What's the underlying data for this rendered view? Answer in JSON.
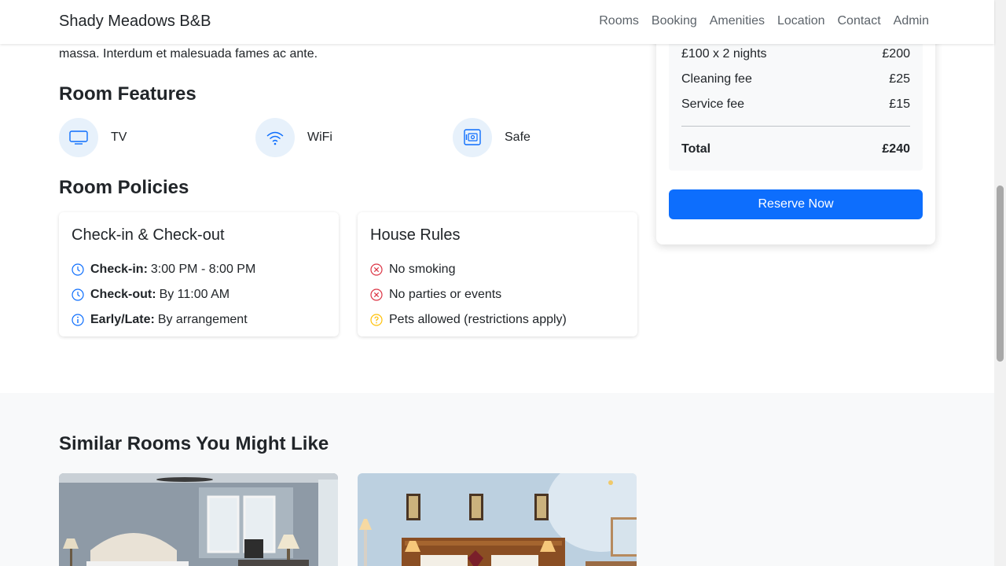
{
  "nav": {
    "brand": "Shady Meadows B&B",
    "links": [
      "Rooms",
      "Booking",
      "Amenities",
      "Location",
      "Contact",
      "Admin"
    ]
  },
  "description_tail": "massa. Interdum et malesuada fames ac ante.",
  "features": {
    "title": "Room Features",
    "items": [
      {
        "label": "TV",
        "icon": "tv-icon"
      },
      {
        "label": "WiFi",
        "icon": "wifi-icon"
      },
      {
        "label": "Safe",
        "icon": "safe-icon"
      }
    ]
  },
  "policies": {
    "title": "Room Policies",
    "checkin_card": {
      "title": "Check-in & Check-out",
      "items": [
        {
          "label": "Check-in:",
          "value": "3:00 PM - 8:00 PM",
          "icon": "clock-icon"
        },
        {
          "label": "Check-out:",
          "value": "By 11:00 AM",
          "icon": "clock-icon"
        },
        {
          "label": "Early/Late:",
          "value": "By arrangement",
          "icon": "info-icon"
        }
      ]
    },
    "rules_card": {
      "title": "House Rules",
      "items": [
        {
          "text": "No smoking",
          "icon": "x-circle-icon"
        },
        {
          "text": "No parties or events",
          "icon": "x-circle-icon"
        },
        {
          "text": "Pets allowed (restrictions apply)",
          "icon": "question-circle-icon"
        }
      ]
    }
  },
  "pricing": {
    "lines": [
      {
        "label": "£100 x 2 nights",
        "amount": "£200"
      },
      {
        "label": "Cleaning fee",
        "amount": "£25"
      },
      {
        "label": "Service fee",
        "amount": "£15"
      }
    ],
    "total_label": "Total",
    "total_amount": "£240",
    "reserve_label": "Reserve Now"
  },
  "similar": {
    "title": "Similar Rooms You Might Like"
  },
  "colors": {
    "primary": "#0d6efd",
    "danger": "#dc3545",
    "warning": "#ffc107",
    "icon_bg": "#e7f1fb"
  }
}
